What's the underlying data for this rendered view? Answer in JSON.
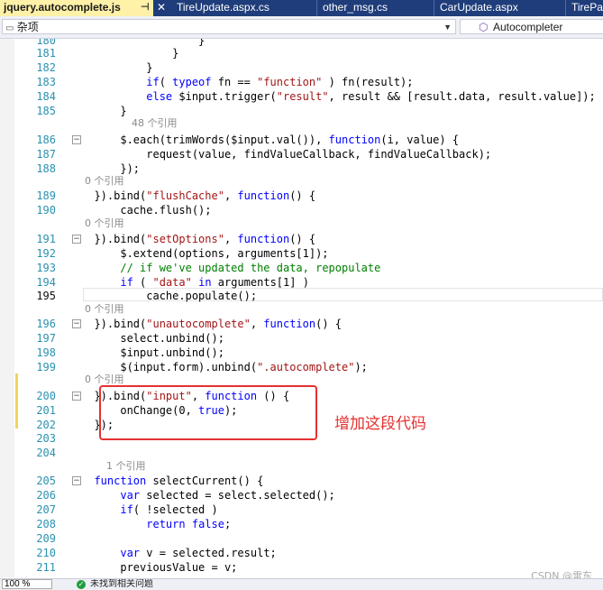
{
  "tabs": [
    {
      "label": "jquery.autocomplete.js",
      "active": true
    },
    {
      "label": "TireUpdate.aspx.cs",
      "active": false
    },
    {
      "label": "other_msg.cs",
      "active": false
    },
    {
      "label": "CarUpdate.aspx",
      "active": false
    },
    {
      "label": "TirePa",
      "active": false
    }
  ],
  "nav": {
    "left_dropdown": "杂项",
    "right_dropdown": "Autocompleter"
  },
  "lines": [
    {
      "n": "180",
      "ref": "",
      "code": "                  }"
    },
    {
      "n": "181",
      "ref": "",
      "code": "              }"
    },
    {
      "n": "182",
      "ref": "",
      "code": "          }"
    },
    {
      "n": "183",
      "ref": "",
      "code": "          if( typeof fn == \"function\" ) fn(result);"
    },
    {
      "n": "184",
      "ref": "",
      "code": "          else $input.trigger(\"result\", result && [result.data, result.value]);"
    },
    {
      "n": "185",
      "ref": "48 个引用",
      "code": "      }"
    },
    {
      "n": "186",
      "ref": "",
      "code": "      $.each(trimWords($input.val()), function(i, value) {"
    },
    {
      "n": "187",
      "ref": "",
      "code": "          request(value, findValueCallback, findValueCallback);"
    },
    {
      "n": "188",
      "ref": "0 个引用",
      "code": "      });"
    },
    {
      "n": "189",
      "ref": "",
      "code": "  }).bind(\"flushCache\", function() {"
    },
    {
      "n": "190",
      "ref": "0 个引用",
      "code": "      cache.flush();"
    },
    {
      "n": "191",
      "ref": "",
      "code": "  }).bind(\"setOptions\", function() {"
    },
    {
      "n": "192",
      "ref": "",
      "code": "      $.extend(options, arguments[1]);"
    },
    {
      "n": "193",
      "ref": "",
      "code": "      // if we've updated the data, repopulate"
    },
    {
      "n": "194",
      "ref": "",
      "code": "      if ( \"data\" in arguments[1] )"
    },
    {
      "n": "195",
      "ref": "0 个引用",
      "code": "          cache.populate();"
    },
    {
      "n": "196",
      "ref": "",
      "code": "  }).bind(\"unautocomplete\", function() {"
    },
    {
      "n": "197",
      "ref": "",
      "code": "      select.unbind();"
    },
    {
      "n": "198",
      "ref": "",
      "code": "      $input.unbind();"
    },
    {
      "n": "199",
      "ref": "0 个引用",
      "code": "      $(input.form).unbind(\".autocomplete\");"
    },
    {
      "n": "200",
      "ref": "",
      "code": "  }).bind(\"input\", function () {"
    },
    {
      "n": "201",
      "ref": "",
      "code": "      onChange(0, true);"
    },
    {
      "n": "202",
      "ref": "",
      "code": "  });"
    },
    {
      "n": "203",
      "ref": "",
      "code": ""
    },
    {
      "n": "204",
      "ref": "1 个引用",
      "code": ""
    },
    {
      "n": "205",
      "ref": "",
      "code": "  function selectCurrent() {"
    },
    {
      "n": "206",
      "ref": "",
      "code": "      var selected = select.selected();"
    },
    {
      "n": "207",
      "ref": "",
      "code": "      if( !selected )"
    },
    {
      "n": "208",
      "ref": "",
      "code": "          return false;"
    },
    {
      "n": "209",
      "ref": "",
      "code": ""
    },
    {
      "n": "210",
      "ref": "",
      "code": "      var v = selected.result;"
    },
    {
      "n": "211",
      "ref": "",
      "code": "      previousValue = v;"
    }
  ],
  "annotation": "增加这段代码",
  "watermark": "CSDN @雷东",
  "status": {
    "zoom": "100 %",
    "message": "未找到相关问题"
  },
  "colors": {
    "keyword": "#0000ff",
    "string": "#a31515",
    "comment": "#008000",
    "linenum": "#2b91af",
    "annotation": "#e53030"
  }
}
